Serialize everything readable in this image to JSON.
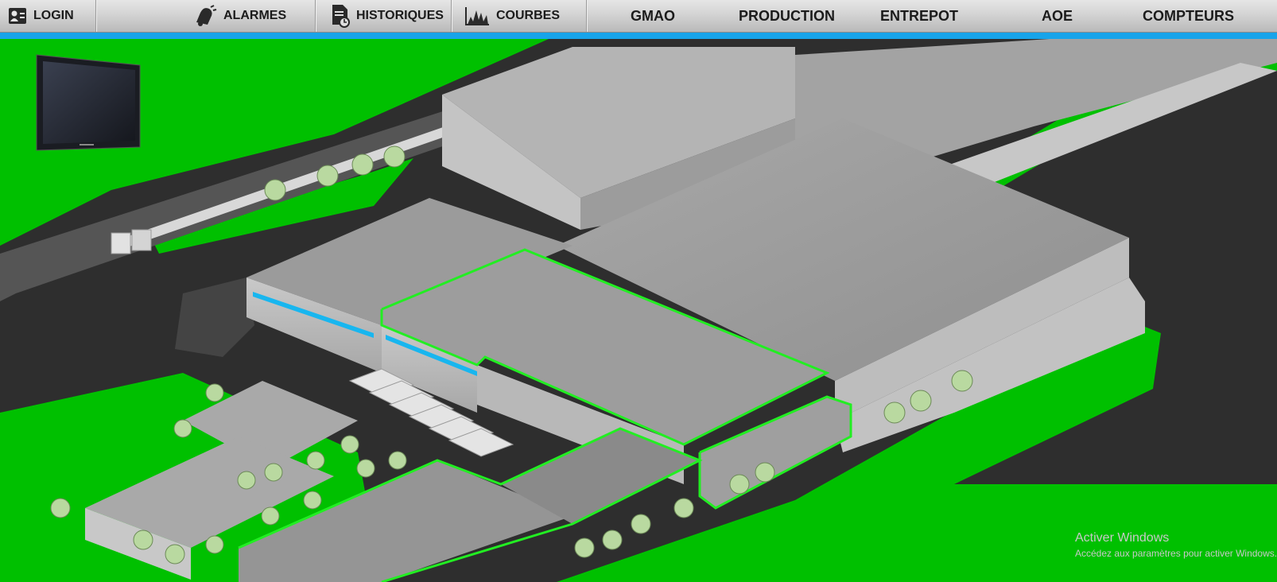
{
  "nav": {
    "login": "LOGIN",
    "alarmes": "ALARMES",
    "historiques": "HISTORIQUES",
    "courbes": "COURBES",
    "gmao": "GMAO",
    "production": "PRODUCTION",
    "entrepot": "ENTREPOT",
    "aoe": "AOE",
    "compteurs": "COMPTEURS"
  },
  "watermark": {
    "title": "Activer Windows",
    "subtitle": "Accédez aux paramètres pour activer Windows."
  },
  "colors": {
    "accent": "#17a4ea",
    "grass": "#00c000",
    "highlight": "#22ee22"
  }
}
